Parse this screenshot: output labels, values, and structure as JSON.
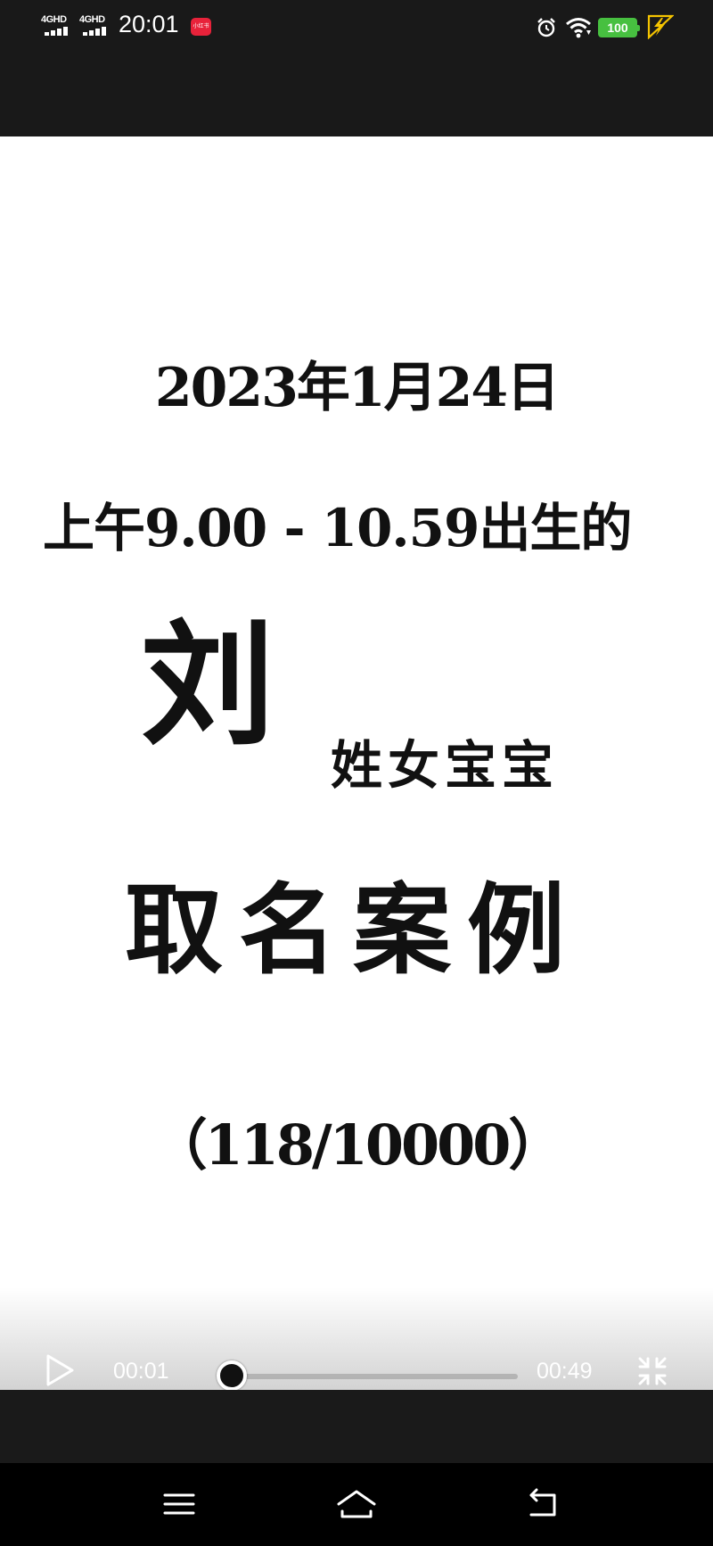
{
  "status_bar": {
    "sim1": "4GHD",
    "sim2": "4GHD",
    "time": "20:01",
    "notification_badge": "小红书",
    "battery": "100",
    "icons": [
      "signal-icon",
      "signal-icon",
      "notification-app-icon",
      "alarm-icon",
      "wifi-icon",
      "battery-icon",
      "charging-icon"
    ]
  },
  "video": {
    "date_line": "2023年1月24日",
    "time_line": "上午9.00 - 10.59出生的",
    "surname": "刘",
    "surname_suffix": "姓女宝宝",
    "heading": "取名案例",
    "counter": "（118/10000）"
  },
  "player": {
    "current_time": "00:01",
    "duration": "00:49",
    "progress": 0.02,
    "icons": [
      "play-icon",
      "exit-fullscreen-icon"
    ]
  },
  "nav_bar": {
    "icons": [
      "menu-icon",
      "home-icon",
      "back-icon"
    ]
  },
  "colors": {
    "status_bar_bg": "#191919",
    "video_bg": "#ffffff",
    "battery": "#47c040",
    "charge": "#f5c400",
    "badge": "#e8223a"
  }
}
